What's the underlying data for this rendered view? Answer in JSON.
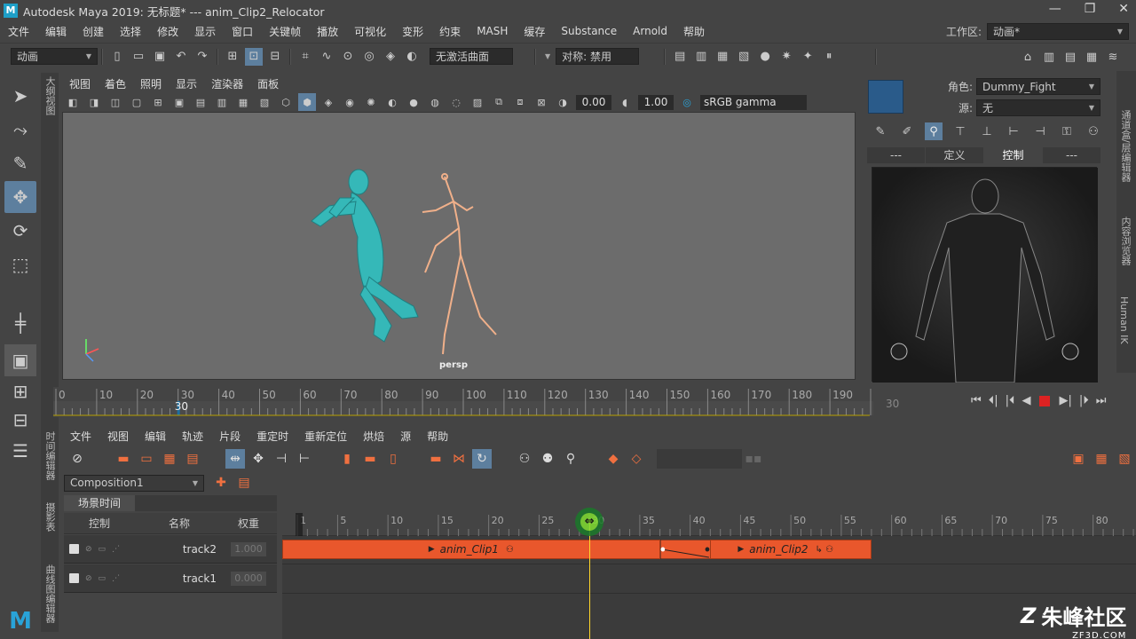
{
  "window": {
    "title": "Autodesk Maya 2019: 无标题*   ---   anim_Clip2_Relocator",
    "logo": "M",
    "minimize": "—",
    "maximize": "❐",
    "close": "✕"
  },
  "menubar": {
    "items": [
      "文件",
      "编辑",
      "创建",
      "选择",
      "修改",
      "显示",
      "窗口",
      "关键帧",
      "播放",
      "可视化",
      "变形",
      "约束",
      "MASH",
      "缓存",
      "Substance",
      "Arnold",
      "帮助"
    ],
    "workspace_label": "工作区:",
    "workspace_value": "动画*"
  },
  "statusline": {
    "menuset": "动画",
    "selection_mode": "无激活曲面",
    "symmetry": "对称: 禁用"
  },
  "sidebar_left": {
    "tab_label": "大纲视图"
  },
  "viewport": {
    "menu": [
      "视图",
      "着色",
      "照明",
      "显示",
      "渲染器",
      "面板"
    ],
    "exposure": "0.00",
    "gamma": "1.00",
    "color_space": "sRGB gamma",
    "camera_label": "persp"
  },
  "hik": {
    "character_label": "角色:",
    "character_value": "Dummy_Fight",
    "source_label": "源:",
    "source_value": "无",
    "tabs": [
      "---",
      "定义",
      "控制",
      "---"
    ],
    "selected_tab": "控制"
  },
  "right_tabs": [
    "通道盒/层编辑器",
    "内容浏览器",
    "Human IK"
  ],
  "time_slider": {
    "ticks": [
      "0",
      "10",
      "20",
      "30",
      "40",
      "50",
      "60",
      "70",
      "80",
      "90",
      "100",
      "110",
      "120",
      "130",
      "140",
      "150",
      "160",
      "170",
      "180",
      "190",
      "20"
    ],
    "ticks_offset": 0,
    "current_frame": "30",
    "current_frame_field": "30"
  },
  "time_editor": {
    "side_tab": "时间编辑器",
    "side_tab2": "摄影表",
    "side_tab3": "曲线图编辑器",
    "menu": [
      "文件",
      "视图",
      "编辑",
      "轨迹",
      "片段",
      "重定时",
      "重新定位",
      "烘焙",
      "源",
      "帮助"
    ],
    "composition": "Composition1",
    "scene_tab": "场景时间",
    "headers": {
      "control": "控制",
      "name": "名称",
      "weight": "权重"
    },
    "tracks": [
      {
        "name": "track2",
        "weight": "1.000"
      },
      {
        "name": "track1",
        "weight": "0.000"
      }
    ],
    "ruler": [
      "1",
      "5",
      "10",
      "15",
      "20",
      "25",
      "30",
      "35",
      "40",
      "45",
      "50",
      "55",
      "60",
      "65",
      "70",
      "75",
      "80"
    ],
    "clips": [
      {
        "name": "anim_Clip1",
        "start": -1,
        "end": 37
      },
      {
        "name": "anim_Clip2",
        "start": 42,
        "end": 58
      }
    ],
    "blend": {
      "start": 37,
      "end": 42
    },
    "playhead_frame": 30
  },
  "watermark": {
    "text": "朱峰社区",
    "url": "ZF3D.COM",
    "mark": "Z"
  }
}
